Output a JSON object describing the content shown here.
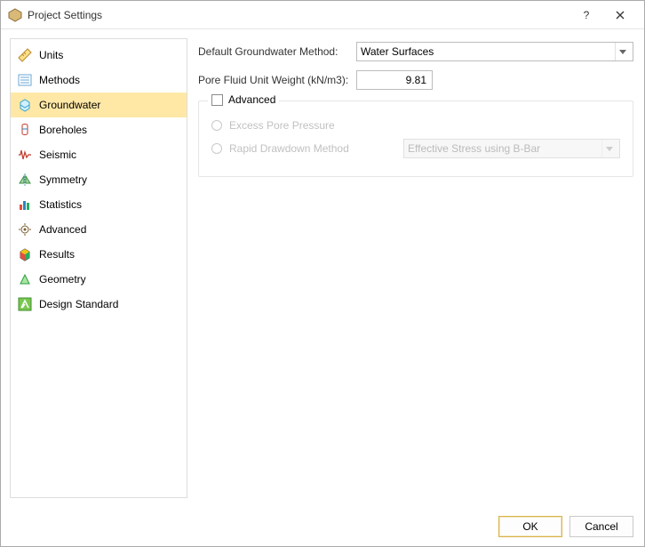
{
  "window": {
    "title": "Project Settings"
  },
  "sidebar": {
    "items": [
      {
        "label": "Units"
      },
      {
        "label": "Methods"
      },
      {
        "label": "Groundwater"
      },
      {
        "label": "Boreholes"
      },
      {
        "label": "Seismic"
      },
      {
        "label": "Symmetry"
      },
      {
        "label": "Statistics"
      },
      {
        "label": "Advanced"
      },
      {
        "label": "Results"
      },
      {
        "label": "Geometry"
      },
      {
        "label": "Design Standard"
      }
    ],
    "selected_index": 2
  },
  "form": {
    "default_method_label": "Default Groundwater Method:",
    "default_method_value": "Water Surfaces",
    "pore_weight_label": "Pore Fluid Unit Weight (kN/m3):",
    "pore_weight_value": "9.81",
    "advanced_legend": "Advanced",
    "excess_pore_label": "Excess Pore Pressure",
    "rapid_drawdown_label": "Rapid Drawdown Method",
    "rapid_drawdown_value": "Effective Stress using B-Bar"
  },
  "buttons": {
    "ok": "OK",
    "cancel": "Cancel"
  }
}
